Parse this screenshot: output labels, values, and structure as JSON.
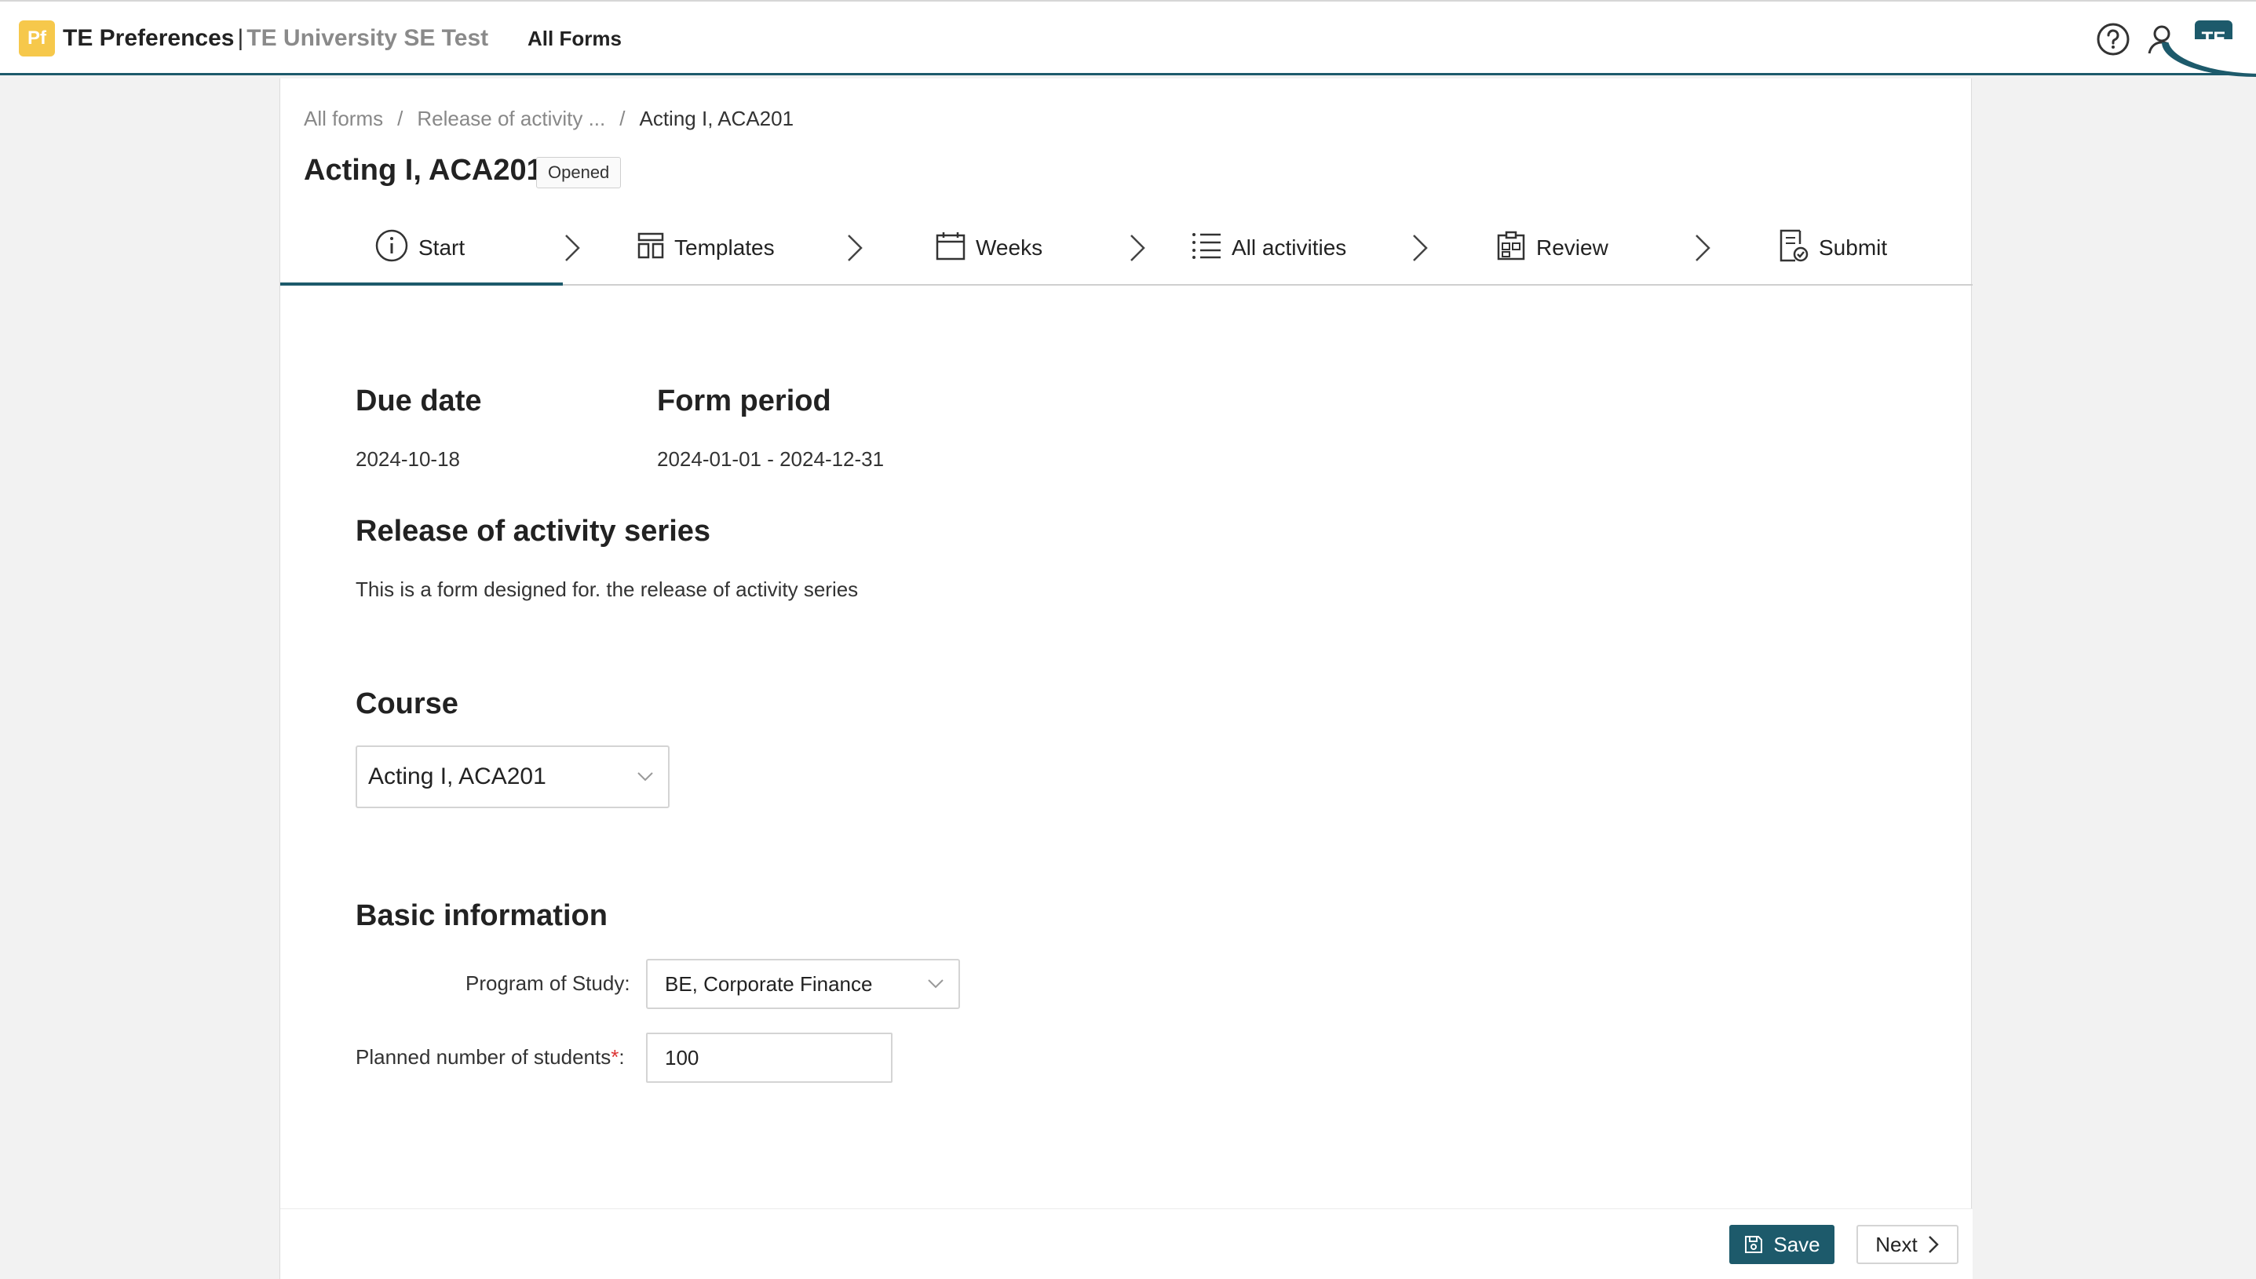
{
  "header": {
    "logo_text": "Pf",
    "app_name": "TE Preferences",
    "separator": "|",
    "org_name": "TE University SE Test",
    "nav_all_forms": "All Forms",
    "avatar_initials": "TE",
    "icons": [
      "help-icon",
      "user-icon"
    ]
  },
  "breadcrumb": {
    "items": [
      "All forms",
      "Release of activity ...",
      "Acting I, ACA201"
    ],
    "separator": "/"
  },
  "page": {
    "title": "Acting I, ACA201",
    "status": "Opened"
  },
  "steps": [
    {
      "label": "Start",
      "icon": "info-icon",
      "active": true
    },
    {
      "label": "Templates",
      "icon": "template-icon",
      "active": false
    },
    {
      "label": "Weeks",
      "icon": "calendar-icon",
      "active": false
    },
    {
      "label": "All activities",
      "icon": "list-icon",
      "active": false
    },
    {
      "label": "Review",
      "icon": "review-icon",
      "active": false
    },
    {
      "label": "Submit",
      "icon": "submit-icon",
      "active": false
    }
  ],
  "form": {
    "due_date_label": "Due date",
    "due_date_value": "2024-10-18",
    "period_label": "Form period",
    "period_value": "2024-01-01 - 2024-12-31",
    "series_heading": "Release of activity series",
    "series_description": "This is a form designed for. the release of activity series",
    "course_heading": "Course",
    "course_value": "Acting I, ACA201",
    "basic_heading": "Basic information",
    "program_label": "Program of Study",
    "program_value": "BE, Corporate Finance",
    "students_label": "Planned number of students",
    "students_required_mark": "*",
    "students_value": "100",
    "colon": ":"
  },
  "footer": {
    "save_label": "Save",
    "next_label": "Next"
  },
  "colors": {
    "accent": "#1d5a6b",
    "logo": "#f6c84b",
    "required": "#dd3333"
  }
}
